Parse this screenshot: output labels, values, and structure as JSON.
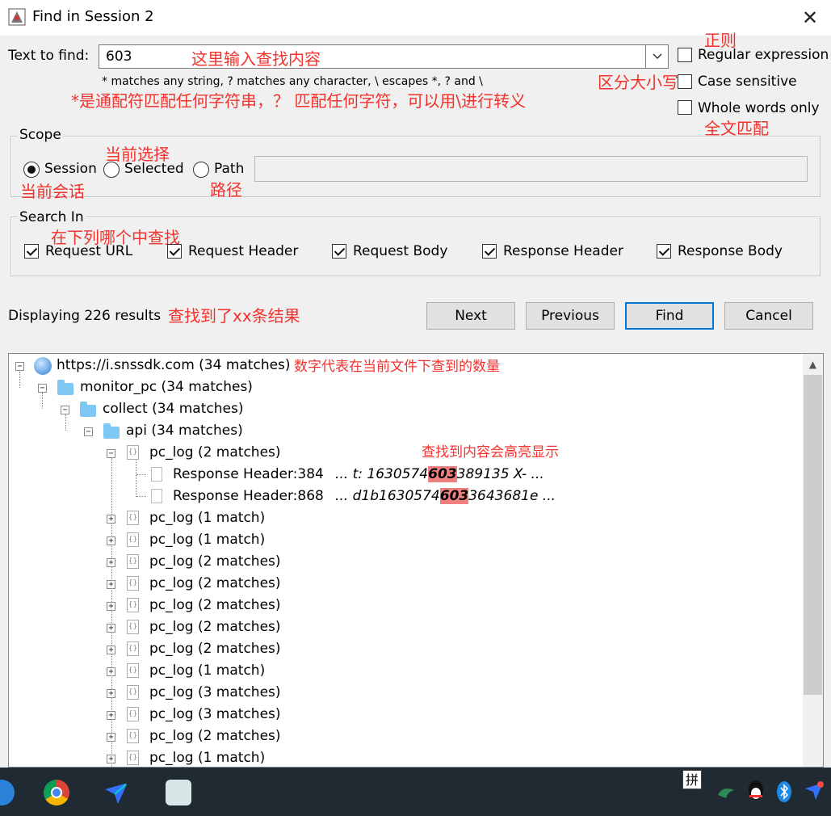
{
  "window": {
    "title": "Find in Session 2",
    "close_glyph": "✕"
  },
  "find": {
    "label": "Text to find:",
    "value": "603",
    "hint": "* matches any string, ? matches any character, \\ escapes *, ? and \\",
    "dropdown_icon": "chevron-down-icon"
  },
  "options": {
    "regex": {
      "label": "Regular expression",
      "checked": false
    },
    "case": {
      "label": "Case sensitive",
      "checked": false
    },
    "whole": {
      "label": "Whole words only",
      "checked": false
    }
  },
  "scope": {
    "title": "Scope",
    "session": "Session",
    "selected": "Selected",
    "path": "Path",
    "path_value": ""
  },
  "search_in": {
    "title": "Search In",
    "items": [
      "Request URL",
      "Request Header",
      "Request Body",
      "Response Header",
      "Response Body"
    ]
  },
  "results": {
    "status": "Displaying 226 results"
  },
  "buttons": {
    "next": "Next",
    "previous": "Previous",
    "find": "Find",
    "cancel": "Cancel"
  },
  "annotations": {
    "input_hint": "这里输入查找内容",
    "regex": "正则",
    "case": "区分大小写",
    "whole": "全文匹配",
    "wildcard": "*是通配符匹配任何字符串，？ 匹配任何字符，可以用\\进行转义",
    "selected": "当前选择",
    "session": "当前会话",
    "path": "路径",
    "search_in": "在下列哪个中查找",
    "results": "查找到了xx条结果",
    "count": "数字代表在当前文件下查到的数量",
    "highlight": "查找到内容会高亮显示"
  },
  "tree": {
    "root": "https://i.snssdk.com (34 matches)",
    "l1": "monitor_pc (34 matches)",
    "l2": "collect (34 matches)",
    "l3": "api (34 matches)",
    "expanded": "pc_log (2 matches)",
    "leaves": [
      {
        "label": "Response Header:384",
        "pre": "... t: 1630574",
        "match": "603",
        "post": "389135 X- ..."
      },
      {
        "label": "Response Header:868",
        "pre": "... d1b1630574",
        "match": "603",
        "post": "3643681e  ..."
      }
    ],
    "collapsed": [
      "pc_log (1 match)",
      "pc_log (1 match)",
      "pc_log (2 matches)",
      "pc_log (2 matches)",
      "pc_log (2 matches)",
      "pc_log (2 matches)",
      "pc_log (2 matches)",
      "pc_log (1 match)",
      "pc_log (3 matches)",
      "pc_log (3 matches)",
      "pc_log (2 matches)",
      "pc_log (1 match)"
    ]
  },
  "taskbar": {
    "ime_label": "拼",
    "apps": [
      "chrome-icon",
      "feishu-icon",
      "fiddler-icon"
    ],
    "tray": [
      "ime-icon",
      "vpn-icon",
      "qq-icon",
      "bluetooth-icon",
      "feishu-tray-icon"
    ]
  },
  "colors": {
    "annotation": "#f2322c",
    "highlight": "#f08080",
    "accent": "#0078d7",
    "taskbar": "#1f2a33"
  }
}
